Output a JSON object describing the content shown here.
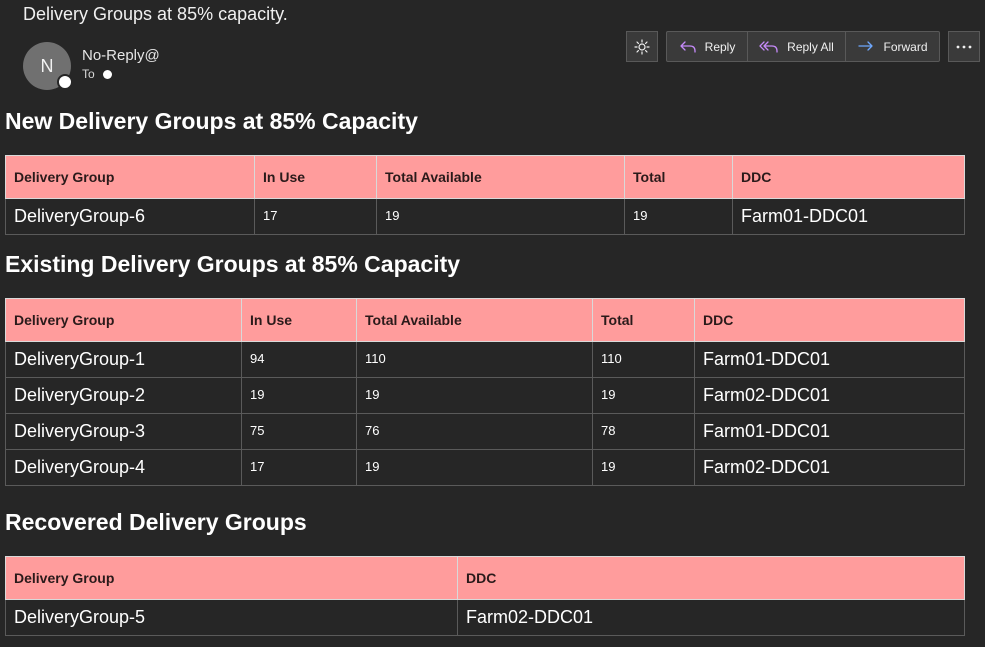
{
  "email": {
    "subject": "Delivery Groups at 85% capacity.",
    "sender_initial": "N",
    "sender": "No-Reply@",
    "to_label": "To"
  },
  "toolbar": {
    "reply": "Reply",
    "reply_all": "Reply All",
    "forward": "Forward"
  },
  "colors": {
    "background": "#262626",
    "header_fill": "#ff9c9c",
    "reply_icon": "#c58af9",
    "forward_icon": "#6ea8fe"
  },
  "sections": {
    "new": {
      "title": "New Delivery Groups at 85% Capacity",
      "headers": [
        "Delivery Group",
        "In Use",
        "Total Available",
        "Total",
        "DDC"
      ],
      "rows": [
        [
          "DeliveryGroup-6",
          "17",
          "19",
          "19",
          "Farm01-DDC01"
        ]
      ]
    },
    "existing": {
      "title": "Existing Delivery Groups at 85% Capacity",
      "headers": [
        "Delivery Group",
        "In Use",
        "Total Available",
        "Total",
        "DDC"
      ],
      "rows": [
        [
          "DeliveryGroup-1",
          "94",
          "110",
          "110",
          "Farm01-DDC01"
        ],
        [
          "DeliveryGroup-2",
          "19",
          "19",
          "19",
          "Farm02-DDC01"
        ],
        [
          "DeliveryGroup-3",
          "75",
          "76",
          "78",
          "Farm01-DDC01"
        ],
        [
          "DeliveryGroup-4",
          "17",
          "19",
          "19",
          "Farm02-DDC01"
        ]
      ]
    },
    "recovered": {
      "title": "Recovered Delivery Groups",
      "headers": [
        "Delivery Group",
        "DDC"
      ],
      "rows": [
        [
          "DeliveryGroup-5",
          "Farm02-DDC01"
        ]
      ]
    }
  }
}
